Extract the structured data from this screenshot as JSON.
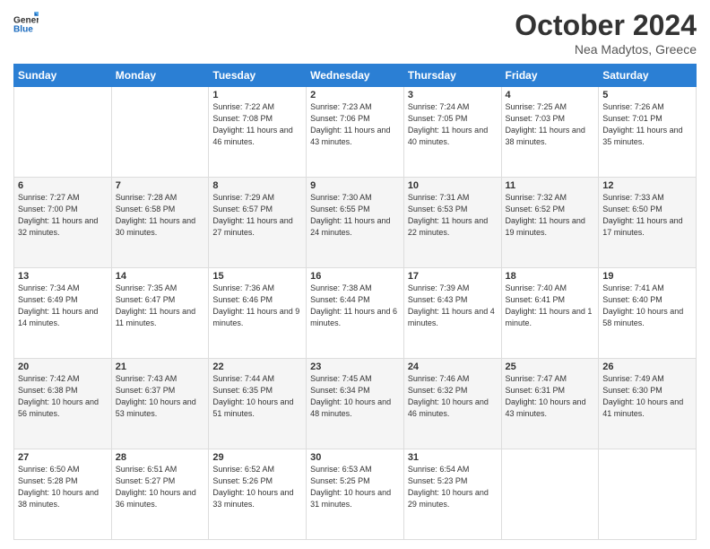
{
  "header": {
    "logo_line1": "General",
    "logo_line2": "Blue",
    "month": "October 2024",
    "location": "Nea Madytos, Greece"
  },
  "weekdays": [
    "Sunday",
    "Monday",
    "Tuesday",
    "Wednesday",
    "Thursday",
    "Friday",
    "Saturday"
  ],
  "weeks": [
    [
      {
        "day": "",
        "sunrise": "",
        "sunset": "",
        "daylight": ""
      },
      {
        "day": "",
        "sunrise": "",
        "sunset": "",
        "daylight": ""
      },
      {
        "day": "1",
        "sunrise": "Sunrise: 7:22 AM",
        "sunset": "Sunset: 7:08 PM",
        "daylight": "Daylight: 11 hours and 46 minutes."
      },
      {
        "day": "2",
        "sunrise": "Sunrise: 7:23 AM",
        "sunset": "Sunset: 7:06 PM",
        "daylight": "Daylight: 11 hours and 43 minutes."
      },
      {
        "day": "3",
        "sunrise": "Sunrise: 7:24 AM",
        "sunset": "Sunset: 7:05 PM",
        "daylight": "Daylight: 11 hours and 40 minutes."
      },
      {
        "day": "4",
        "sunrise": "Sunrise: 7:25 AM",
        "sunset": "Sunset: 7:03 PM",
        "daylight": "Daylight: 11 hours and 38 minutes."
      },
      {
        "day": "5",
        "sunrise": "Sunrise: 7:26 AM",
        "sunset": "Sunset: 7:01 PM",
        "daylight": "Daylight: 11 hours and 35 minutes."
      }
    ],
    [
      {
        "day": "6",
        "sunrise": "Sunrise: 7:27 AM",
        "sunset": "Sunset: 7:00 PM",
        "daylight": "Daylight: 11 hours and 32 minutes."
      },
      {
        "day": "7",
        "sunrise": "Sunrise: 7:28 AM",
        "sunset": "Sunset: 6:58 PM",
        "daylight": "Daylight: 11 hours and 30 minutes."
      },
      {
        "day": "8",
        "sunrise": "Sunrise: 7:29 AM",
        "sunset": "Sunset: 6:57 PM",
        "daylight": "Daylight: 11 hours and 27 minutes."
      },
      {
        "day": "9",
        "sunrise": "Sunrise: 7:30 AM",
        "sunset": "Sunset: 6:55 PM",
        "daylight": "Daylight: 11 hours and 24 minutes."
      },
      {
        "day": "10",
        "sunrise": "Sunrise: 7:31 AM",
        "sunset": "Sunset: 6:53 PM",
        "daylight": "Daylight: 11 hours and 22 minutes."
      },
      {
        "day": "11",
        "sunrise": "Sunrise: 7:32 AM",
        "sunset": "Sunset: 6:52 PM",
        "daylight": "Daylight: 11 hours and 19 minutes."
      },
      {
        "day": "12",
        "sunrise": "Sunrise: 7:33 AM",
        "sunset": "Sunset: 6:50 PM",
        "daylight": "Daylight: 11 hours and 17 minutes."
      }
    ],
    [
      {
        "day": "13",
        "sunrise": "Sunrise: 7:34 AM",
        "sunset": "Sunset: 6:49 PM",
        "daylight": "Daylight: 11 hours and 14 minutes."
      },
      {
        "day": "14",
        "sunrise": "Sunrise: 7:35 AM",
        "sunset": "Sunset: 6:47 PM",
        "daylight": "Daylight: 11 hours and 11 minutes."
      },
      {
        "day": "15",
        "sunrise": "Sunrise: 7:36 AM",
        "sunset": "Sunset: 6:46 PM",
        "daylight": "Daylight: 11 hours and 9 minutes."
      },
      {
        "day": "16",
        "sunrise": "Sunrise: 7:38 AM",
        "sunset": "Sunset: 6:44 PM",
        "daylight": "Daylight: 11 hours and 6 minutes."
      },
      {
        "day": "17",
        "sunrise": "Sunrise: 7:39 AM",
        "sunset": "Sunset: 6:43 PM",
        "daylight": "Daylight: 11 hours and 4 minutes."
      },
      {
        "day": "18",
        "sunrise": "Sunrise: 7:40 AM",
        "sunset": "Sunset: 6:41 PM",
        "daylight": "Daylight: 11 hours and 1 minute."
      },
      {
        "day": "19",
        "sunrise": "Sunrise: 7:41 AM",
        "sunset": "Sunset: 6:40 PM",
        "daylight": "Daylight: 10 hours and 58 minutes."
      }
    ],
    [
      {
        "day": "20",
        "sunrise": "Sunrise: 7:42 AM",
        "sunset": "Sunset: 6:38 PM",
        "daylight": "Daylight: 10 hours and 56 minutes."
      },
      {
        "day": "21",
        "sunrise": "Sunrise: 7:43 AM",
        "sunset": "Sunset: 6:37 PM",
        "daylight": "Daylight: 10 hours and 53 minutes."
      },
      {
        "day": "22",
        "sunrise": "Sunrise: 7:44 AM",
        "sunset": "Sunset: 6:35 PM",
        "daylight": "Daylight: 10 hours and 51 minutes."
      },
      {
        "day": "23",
        "sunrise": "Sunrise: 7:45 AM",
        "sunset": "Sunset: 6:34 PM",
        "daylight": "Daylight: 10 hours and 48 minutes."
      },
      {
        "day": "24",
        "sunrise": "Sunrise: 7:46 AM",
        "sunset": "Sunset: 6:32 PM",
        "daylight": "Daylight: 10 hours and 46 minutes."
      },
      {
        "day": "25",
        "sunrise": "Sunrise: 7:47 AM",
        "sunset": "Sunset: 6:31 PM",
        "daylight": "Daylight: 10 hours and 43 minutes."
      },
      {
        "day": "26",
        "sunrise": "Sunrise: 7:49 AM",
        "sunset": "Sunset: 6:30 PM",
        "daylight": "Daylight: 10 hours and 41 minutes."
      }
    ],
    [
      {
        "day": "27",
        "sunrise": "Sunrise: 6:50 AM",
        "sunset": "Sunset: 5:28 PM",
        "daylight": "Daylight: 10 hours and 38 minutes."
      },
      {
        "day": "28",
        "sunrise": "Sunrise: 6:51 AM",
        "sunset": "Sunset: 5:27 PM",
        "daylight": "Daylight: 10 hours and 36 minutes."
      },
      {
        "day": "29",
        "sunrise": "Sunrise: 6:52 AM",
        "sunset": "Sunset: 5:26 PM",
        "daylight": "Daylight: 10 hours and 33 minutes."
      },
      {
        "day": "30",
        "sunrise": "Sunrise: 6:53 AM",
        "sunset": "Sunset: 5:25 PM",
        "daylight": "Daylight: 10 hours and 31 minutes."
      },
      {
        "day": "31",
        "sunrise": "Sunrise: 6:54 AM",
        "sunset": "Sunset: 5:23 PM",
        "daylight": "Daylight: 10 hours and 29 minutes."
      },
      {
        "day": "",
        "sunrise": "",
        "sunset": "",
        "daylight": ""
      },
      {
        "day": "",
        "sunrise": "",
        "sunset": "",
        "daylight": ""
      }
    ]
  ]
}
